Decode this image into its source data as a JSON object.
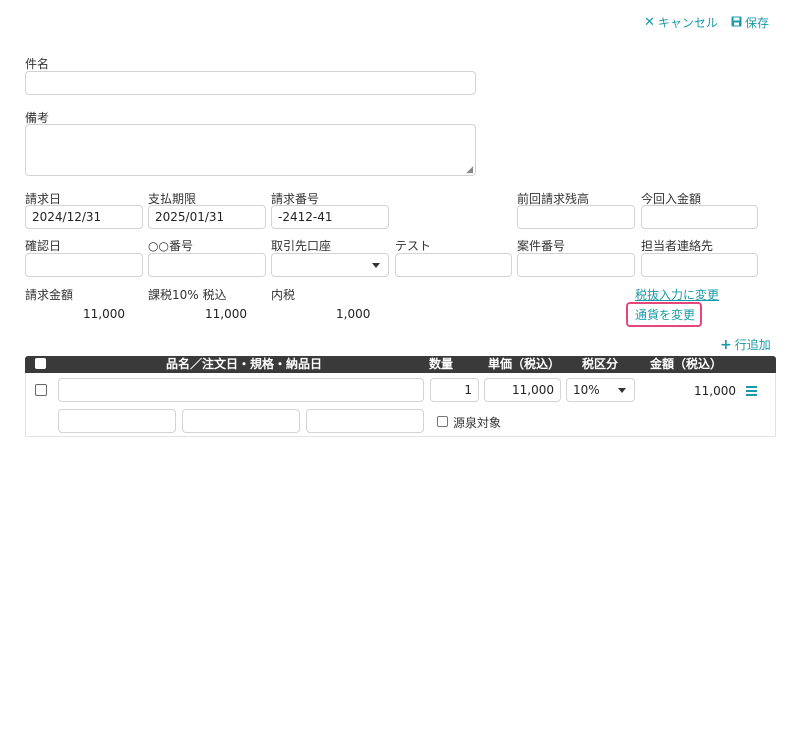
{
  "toolbar": {
    "cancel_label": "キャンセル",
    "save_label": "保存",
    "cancel_icon": "close-icon",
    "save_icon": "floppy-disk-icon"
  },
  "form": {
    "subject_label": "件名",
    "subject_value": "",
    "remarks_label": "備考",
    "remarks_value": "",
    "invoice_date_label": "請求日",
    "invoice_date_value": "2024/12/31",
    "due_date_label": "支払期限",
    "due_date_value": "2025/01/31",
    "invoice_number_label": "請求番号",
    "invoice_number_value": "-2412-41",
    "prev_balance_label": "前回請求残高",
    "prev_balance_value": "",
    "payment_amount_label": "今回入金額",
    "payment_amount_value": "",
    "confirm_date_label": "確認日",
    "confirm_date_value": "",
    "oo_number_label": "○○番号",
    "oo_number_value": "",
    "bank_account_label": "取引先口座",
    "bank_account_value": "",
    "test_label": "テスト",
    "test_value": "",
    "project_number_label": "案件番号",
    "project_number_value": "",
    "contact_label": "担当者連絡先",
    "contact_value": ""
  },
  "summary": {
    "total_label": "請求金額",
    "total_value": "11,000",
    "taxable_label": "課税10% 税込",
    "taxable_value": "11,000",
    "inner_tax_label": "内税",
    "inner_tax_value": "1,000",
    "tax_exclusive_link": "税抜入力に変更",
    "currency_link": "通貨を変更"
  },
  "table": {
    "add_row_label": "行追加",
    "headers": {
      "item": "品名／注文日・規格・納品日",
      "quantity": "数量",
      "unit_price": "単価（税込）",
      "tax_category": "税区分",
      "amount": "金額（税込）"
    },
    "rows": [
      {
        "item_value": "",
        "quantity": "1",
        "unit_price": "11,000",
        "tax_category": "10%",
        "amount": "11,000",
        "sub_field_1": "",
        "sub_field_2": "",
        "sub_field_3": "",
        "withholding_label": "源泉対象"
      }
    ]
  },
  "colors": {
    "accent": "#1a9aa8",
    "header_bg": "#3a3a3a",
    "highlight": "#e8457a"
  }
}
